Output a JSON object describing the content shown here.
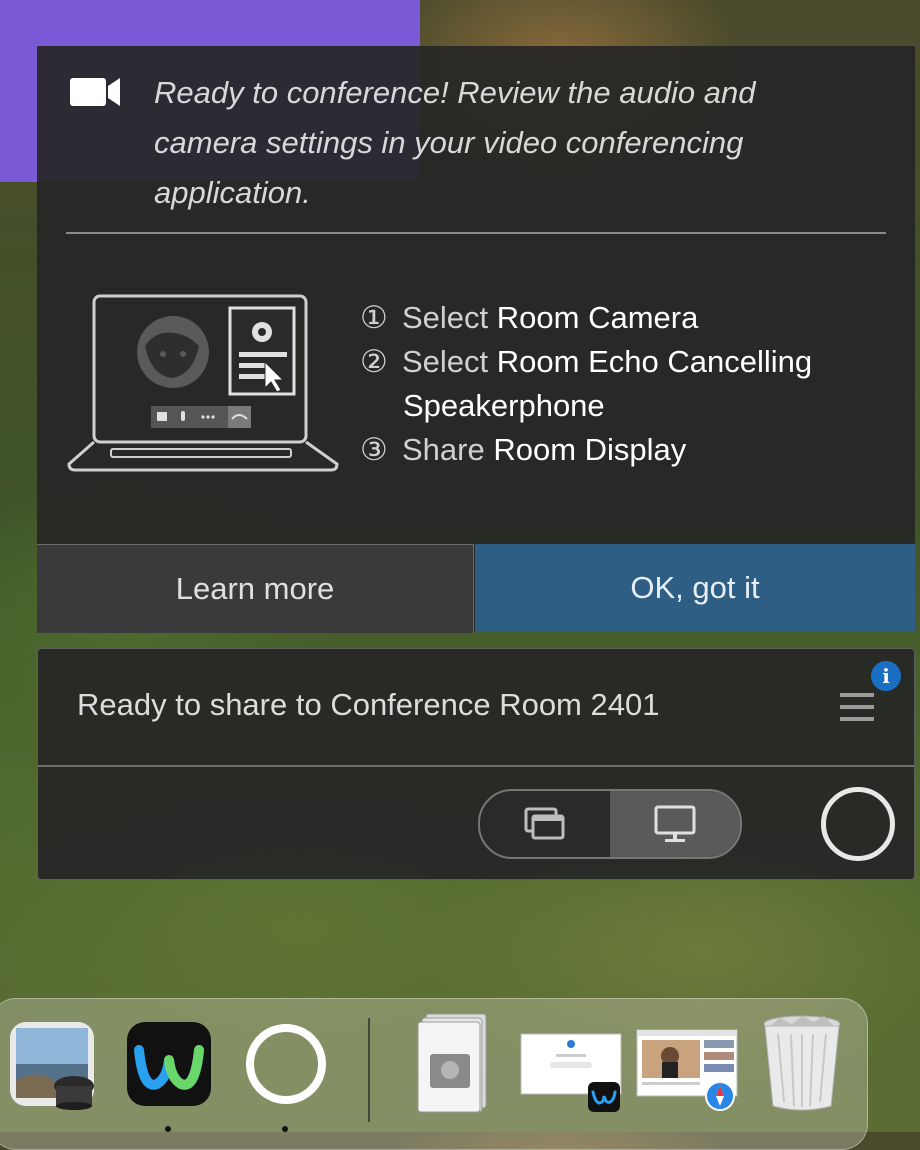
{
  "popup": {
    "message": "Ready to conference! Review the audio and camera settings in your video conferencing application.",
    "steps": [
      {
        "num": "①",
        "prefix": "Select ",
        "bold": "Room Camera"
      },
      {
        "num": "②",
        "prefix": "Select ",
        "bold": "Room Echo Cancelling"
      },
      {
        "num": "",
        "prefix": "",
        "bold": "Speakerphone"
      },
      {
        "num": "③",
        "prefix": "Share ",
        "bold": "Room Display"
      }
    ],
    "learn_more_label": "Learn more",
    "ok_label": "OK, got it",
    "ok_color": "#2e5e84"
  },
  "share_panel": {
    "title": "Ready to share to Conference Room 2401",
    "info_badge": "i",
    "info_color": "#1a6fc2",
    "toggle": {
      "left_icon": "window-share-icon",
      "right_icon": "screen-share-icon",
      "selected": "screen-share"
    }
  },
  "dock": {
    "items": [
      {
        "name": "preview-app-icon"
      },
      {
        "name": "webex-app-icon"
      },
      {
        "name": "circle-app-icon"
      },
      {
        "name": "disk-utility-folder-icon"
      },
      {
        "name": "webex-window-thumbnail"
      },
      {
        "name": "safari-window-thumbnail"
      },
      {
        "name": "trash-icon"
      }
    ]
  }
}
